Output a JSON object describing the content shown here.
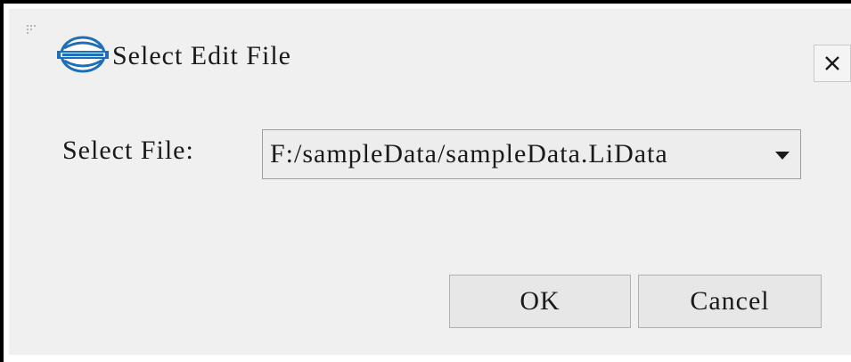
{
  "window": {
    "title": "Select Edit File",
    "logo_icon": "liuhuo-logo-icon",
    "close_icon": "close-icon"
  },
  "form": {
    "label": "Select File:",
    "selected_file": "F:/sampleData/sampleData.LiData"
  },
  "buttons": {
    "ok_label": "OK",
    "cancel_label": "Cancel"
  },
  "colors": {
    "dialog_background": "#f0f0f0",
    "button_background": "#e7e7e7",
    "combo_background": "#ededed",
    "logo_blue": "#1f6fb8"
  }
}
